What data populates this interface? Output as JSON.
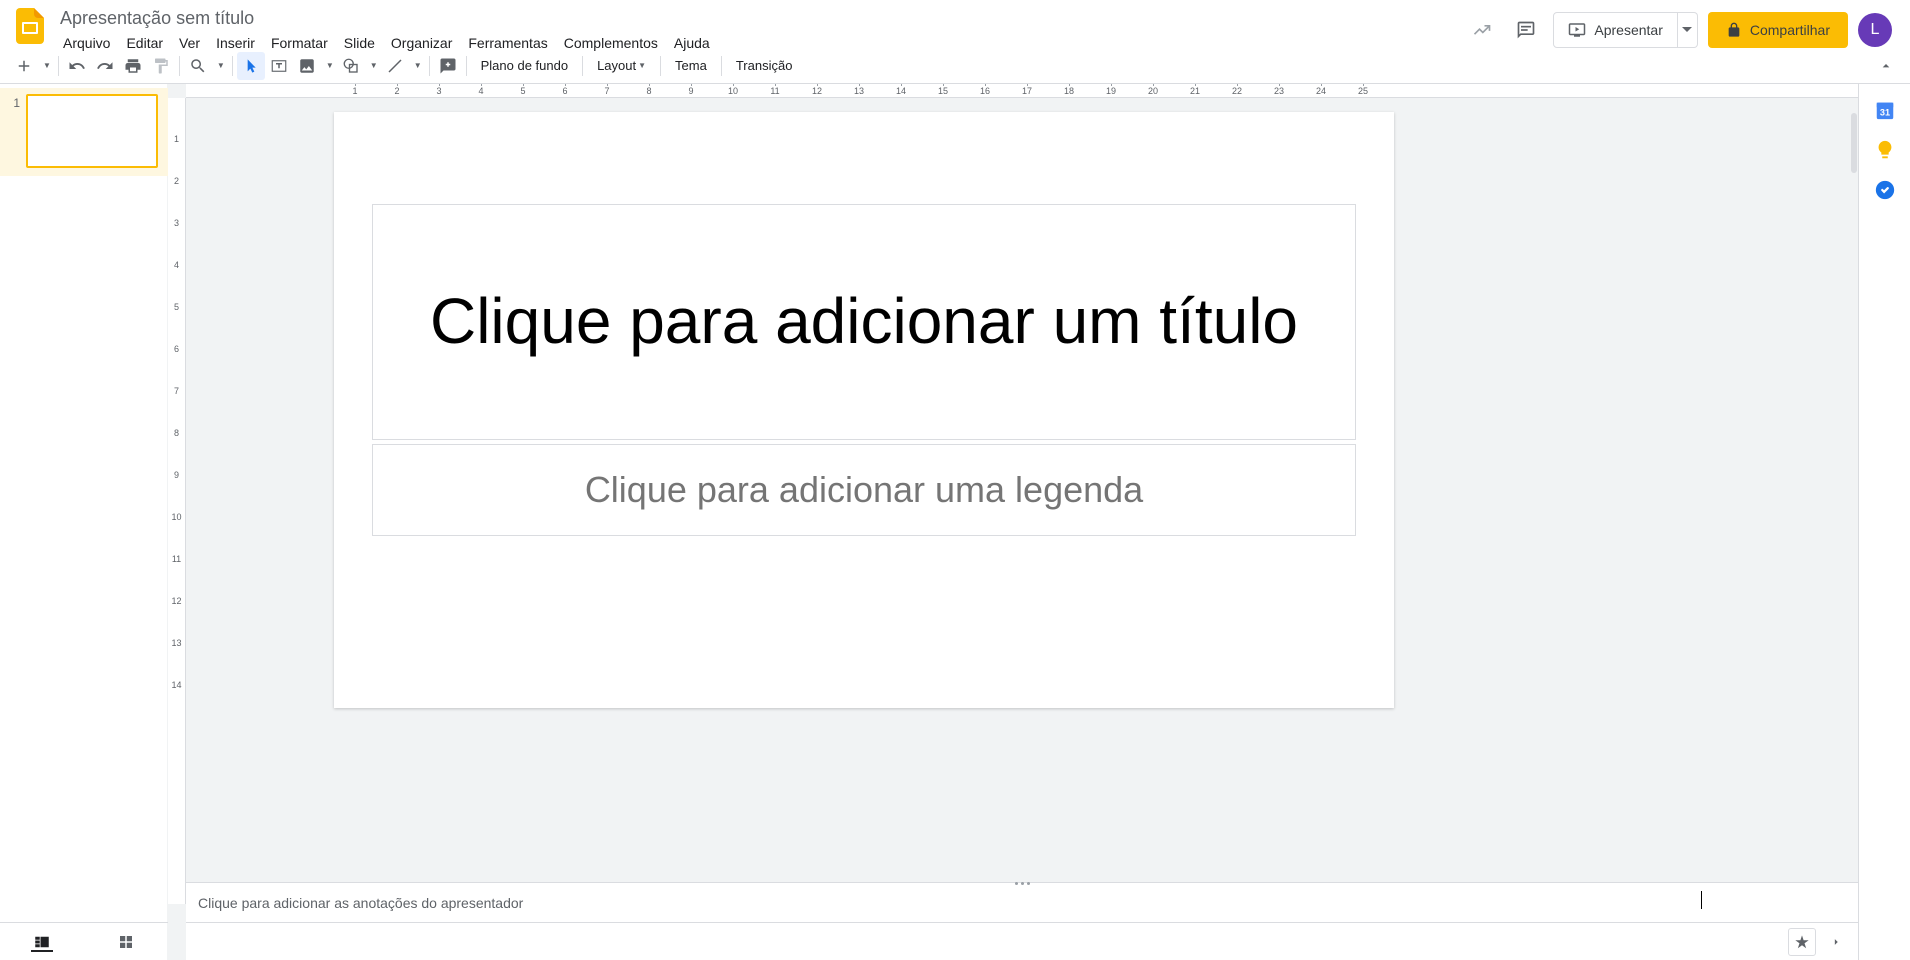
{
  "header": {
    "doc_title": "Apresentação sem título",
    "menus": [
      "Arquivo",
      "Editar",
      "Ver",
      "Inserir",
      "Formatar",
      "Slide",
      "Organizar",
      "Ferramentas",
      "Complementos",
      "Ajuda"
    ],
    "present_label": "Apresentar",
    "share_label": "Compartilhar",
    "avatar_initial": "L"
  },
  "toolbar": {
    "background_label": "Plano de fundo",
    "layout_label": "Layout",
    "theme_label": "Tema",
    "transition_label": "Transição"
  },
  "thumbnails": {
    "items": [
      {
        "number": "1"
      }
    ]
  },
  "ruler_h": [
    "1",
    "2",
    "3",
    "4",
    "5",
    "6",
    "7",
    "8",
    "9",
    "10",
    "11",
    "12",
    "13",
    "14",
    "15",
    "16",
    "17",
    "18",
    "19",
    "20",
    "21",
    "22",
    "23",
    "24",
    "25"
  ],
  "ruler_v": [
    "1",
    "2",
    "3",
    "4",
    "5",
    "6",
    "7",
    "8",
    "9",
    "10",
    "11",
    "12",
    "13",
    "14"
  ],
  "slide": {
    "title_placeholder": "Clique para adicionar um título",
    "subtitle_placeholder": "Clique para adicionar uma legenda"
  },
  "notes": {
    "placeholder": "Clique para adicionar as anotações do apresentador"
  },
  "colors": {
    "accent": "#fbbc04",
    "avatar_bg": "#673ab7"
  }
}
